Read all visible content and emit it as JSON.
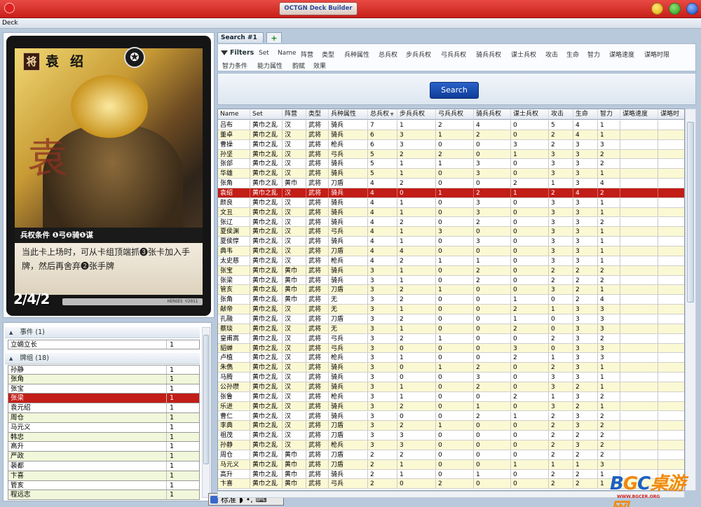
{
  "window": {
    "title": "OCTGN Deck Builder"
  },
  "menu": {
    "items": [
      "Deck"
    ]
  },
  "card": {
    "type_badge": "将",
    "name": "袁绍",
    "art_glyph": "袁",
    "condition": "兵权条件 ❶弓❷骑❶谋",
    "text": "当此卡上场时，可从卡组顶端抓❸张卡加入手牌，然后再舍弃❷张手牌",
    "stats": "2/4/2",
    "copyright": "HEROES ©2011"
  },
  "deck": {
    "sections": [
      {
        "title": "事件 (1)",
        "items": [
          {
            "name": "立嫡立长",
            "qty": "1"
          }
        ]
      },
      {
        "title": "牌组 (18)",
        "items": [
          {
            "name": "孙静",
            "qty": "1"
          },
          {
            "name": "张角",
            "qty": "1"
          },
          {
            "name": "张宝",
            "qty": "1"
          },
          {
            "name": "张梁",
            "qty": "1",
            "selected": true
          },
          {
            "name": "袁元绍",
            "qty": "1"
          },
          {
            "name": "周仓",
            "qty": "1"
          },
          {
            "name": "马元义",
            "qty": "1"
          },
          {
            "name": "韩忠",
            "qty": "1"
          },
          {
            "name": "高升",
            "qty": "1"
          },
          {
            "name": "严政",
            "qty": "1"
          },
          {
            "name": "裴都",
            "qty": "1"
          },
          {
            "name": "卞喜",
            "qty": "1"
          },
          {
            "name": "管亥",
            "qty": "1"
          },
          {
            "name": "程远志",
            "qty": "1"
          }
        ]
      }
    ]
  },
  "ime": {
    "label": "标准"
  },
  "search": {
    "tab_label": "Search #1",
    "add_tab": "+",
    "filters_label": "Filters",
    "filter_items": [
      "Set",
      "Name",
      "阵营",
      "类型",
      "兵种属性",
      "总兵权",
      "步兵兵权",
      "弓兵兵权",
      "骑兵兵权",
      "谋士兵权",
      "攻击",
      "生命",
      "智力",
      "谋略速度",
      "谋略时限",
      "智力条件",
      "能力属性",
      "韵赋",
      "效果"
    ],
    "button_label": "Search"
  },
  "table": {
    "columns": [
      "Name",
      "Set",
      "阵营",
      "类型",
      "兵种属性",
      "总兵权",
      "步兵兵权",
      "弓兵兵权",
      "骑兵兵权",
      "谋士兵权",
      "攻击",
      "生命",
      "智力",
      "谋略速度",
      "谋略时"
    ],
    "sorted_column": "总兵权",
    "rows": [
      [
        "吕布",
        "黄巾之乱",
        "汉",
        "武将",
        "骑兵",
        "7",
        "1",
        "2",
        "4",
        "0",
        "5",
        "4",
        "1"
      ],
      [
        "董卓",
        "黄巾之乱",
        "汉",
        "武将",
        "骑兵",
        "6",
        "3",
        "1",
        "2",
        "0",
        "2",
        "4",
        "1"
      ],
      [
        "曹操",
        "黄巾之乱",
        "汉",
        "武将",
        "枪兵",
        "6",
        "3",
        "0",
        "0",
        "3",
        "2",
        "3",
        "3"
      ],
      [
        "孙坚",
        "黄巾之乱",
        "汉",
        "武将",
        "弓兵",
        "5",
        "2",
        "2",
        "0",
        "1",
        "3",
        "3",
        "2"
      ],
      [
        "张郃",
        "黄巾之乱",
        "汉",
        "武将",
        "骑兵",
        "5",
        "1",
        "1",
        "3",
        "0",
        "3",
        "3",
        "2"
      ],
      [
        "华雄",
        "黄巾之乱",
        "汉",
        "武将",
        "骑兵",
        "5",
        "1",
        "0",
        "3",
        "0",
        "3",
        "3",
        "1"
      ],
      [
        "张角",
        "黄巾之乱",
        "黄巾",
        "武将",
        "刀盾",
        "4",
        "2",
        "0",
        "0",
        "2",
        "1",
        "3",
        "4"
      ],
      [
        "袁绍",
        "黄巾之乱",
        "汉",
        "武将",
        "骑兵",
        "4",
        "0",
        "1",
        "2",
        "1",
        "2",
        "4",
        "2"
      ],
      [
        "颜良",
        "黄巾之乱",
        "汉",
        "武将",
        "骑兵",
        "4",
        "1",
        "0",
        "3",
        "0",
        "3",
        "3",
        "1"
      ],
      [
        "文丑",
        "黄巾之乱",
        "汉",
        "武将",
        "骑兵",
        "4",
        "1",
        "0",
        "3",
        "0",
        "3",
        "3",
        "1"
      ],
      [
        "张辽",
        "黄巾之乱",
        "汉",
        "武将",
        "骑兵",
        "4",
        "2",
        "0",
        "2",
        "0",
        "3",
        "3",
        "2"
      ],
      [
        "夏侯渊",
        "黄巾之乱",
        "汉",
        "武将",
        "弓兵",
        "4",
        "1",
        "3",
        "0",
        "0",
        "3",
        "3",
        "1"
      ],
      [
        "夏侯惇",
        "黄巾之乱",
        "汉",
        "武将",
        "骑兵",
        "4",
        "1",
        "0",
        "3",
        "0",
        "3",
        "3",
        "1"
      ],
      [
        "典韦",
        "黄巾之乱",
        "汉",
        "武将",
        "刀盾",
        "4",
        "4",
        "0",
        "0",
        "0",
        "3",
        "3",
        "1"
      ],
      [
        "太史慈",
        "黄巾之乱",
        "汉",
        "武将",
        "枪兵",
        "4",
        "2",
        "1",
        "1",
        "0",
        "3",
        "3",
        "1"
      ],
      [
        "张宝",
        "黄巾之乱",
        "黄巾",
        "武将",
        "骑兵",
        "3",
        "1",
        "0",
        "2",
        "0",
        "2",
        "2",
        "2"
      ],
      [
        "张梁",
        "黄巾之乱",
        "黄巾",
        "武将",
        "骑兵",
        "3",
        "1",
        "0",
        "2",
        "0",
        "2",
        "2",
        "2"
      ],
      [
        "管亥",
        "黄巾之乱",
        "黄巾",
        "武将",
        "刀盾",
        "3",
        "2",
        "1",
        "0",
        "0",
        "3",
        "2",
        "1"
      ],
      [
        "张角",
        "黄巾之乱",
        "黄巾",
        "武将",
        "无",
        "3",
        "2",
        "0",
        "0",
        "1",
        "0",
        "2",
        "4"
      ],
      [
        "献帝",
        "黄巾之乱",
        "汉",
        "武将",
        "无",
        "3",
        "1",
        "0",
        "0",
        "2",
        "1",
        "3",
        "3"
      ],
      [
        "孔融",
        "黄巾之乱",
        "汉",
        "武将",
        "刀盾",
        "3",
        "2",
        "0",
        "0",
        "1",
        "0",
        "3",
        "3"
      ],
      [
        "蔡琰",
        "黄巾之乱",
        "汉",
        "武将",
        "无",
        "3",
        "1",
        "0",
        "0",
        "2",
        "0",
        "3",
        "3"
      ],
      [
        "皇甫嵩",
        "黄巾之乱",
        "汉",
        "武将",
        "弓兵",
        "3",
        "2",
        "1",
        "0",
        "0",
        "2",
        "3",
        "2"
      ],
      [
        "貂蝉",
        "黄巾之乱",
        "汉",
        "武将",
        "弓兵",
        "3",
        "0",
        "0",
        "0",
        "3",
        "0",
        "3",
        "3"
      ],
      [
        "卢植",
        "黄巾之乱",
        "汉",
        "武将",
        "枪兵",
        "3",
        "1",
        "0",
        "0",
        "2",
        "1",
        "3",
        "3"
      ],
      [
        "朱儁",
        "黄巾之乱",
        "汉",
        "武将",
        "骑兵",
        "3",
        "0",
        "1",
        "2",
        "0",
        "2",
        "3",
        "1"
      ],
      [
        "马腾",
        "黄巾之乱",
        "汉",
        "武将",
        "骑兵",
        "3",
        "0",
        "0",
        "3",
        "0",
        "3",
        "3",
        "1"
      ],
      [
        "公孙瓒",
        "黄巾之乱",
        "汉",
        "武将",
        "骑兵",
        "3",
        "1",
        "0",
        "2",
        "0",
        "3",
        "2",
        "1"
      ],
      [
        "张鲁",
        "黄巾之乱",
        "汉",
        "武将",
        "枪兵",
        "3",
        "1",
        "0",
        "0",
        "2",
        "1",
        "3",
        "2"
      ],
      [
        "乐进",
        "黄巾之乱",
        "汉",
        "武将",
        "骑兵",
        "3",
        "2",
        "0",
        "1",
        "0",
        "3",
        "2",
        "1"
      ],
      [
        "曹仁",
        "黄巾之乱",
        "汉",
        "武将",
        "骑兵",
        "3",
        "0",
        "0",
        "2",
        "1",
        "2",
        "3",
        "2"
      ],
      [
        "李典",
        "黄巾之乱",
        "汉",
        "武将",
        "刀盾",
        "3",
        "2",
        "1",
        "0",
        "0",
        "2",
        "3",
        "2"
      ],
      [
        "祖茂",
        "黄巾之乱",
        "汉",
        "武将",
        "刀盾",
        "3",
        "3",
        "0",
        "0",
        "0",
        "2",
        "2",
        "2"
      ],
      [
        "孙静",
        "黄巾之乱",
        "汉",
        "武将",
        "枪兵",
        "3",
        "3",
        "0",
        "0",
        "0",
        "2",
        "3",
        "2"
      ],
      [
        "周仓",
        "黄巾之乱",
        "黄巾",
        "武将",
        "刀盾",
        "2",
        "2",
        "0",
        "0",
        "0",
        "2",
        "2",
        "2"
      ],
      [
        "马元义",
        "黄巾之乱",
        "黄巾",
        "武将",
        "刀盾",
        "2",
        "1",
        "0",
        "0",
        "1",
        "1",
        "1",
        "3"
      ],
      [
        "高升",
        "黄巾之乱",
        "黄巾",
        "武将",
        "骑兵",
        "2",
        "1",
        "0",
        "1",
        "0",
        "2",
        "2",
        "1"
      ],
      [
        "卞喜",
        "黄巾之乱",
        "黄巾",
        "武将",
        "弓兵",
        "2",
        "0",
        "2",
        "0",
        "0",
        "2",
        "2",
        "1"
      ]
    ]
  },
  "watermark": {
    "brand_a": "B",
    "brand_b": "G",
    "brand_c": "C",
    "brand_d": "桌游网",
    "url": "WWW.BGCER.ORG"
  }
}
